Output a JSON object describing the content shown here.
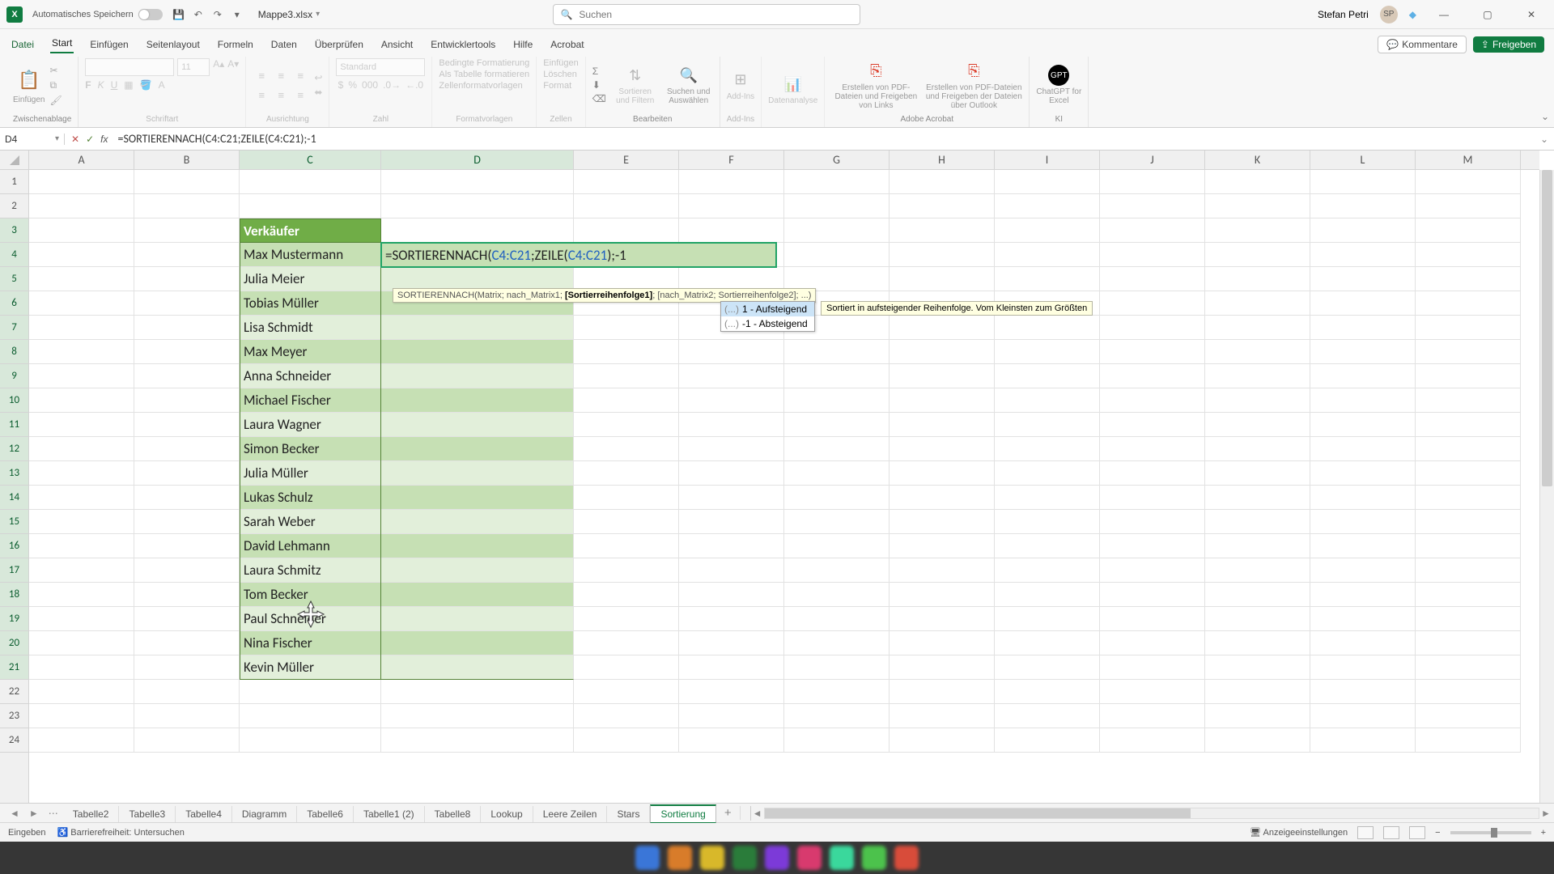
{
  "titlebar": {
    "autosave_label": "Automatisches Speichern",
    "filename": "Mappe3.xlsx",
    "search_placeholder": "Suchen",
    "user_name": "Stefan Petri"
  },
  "ribbon_tabs": {
    "file": "Datei",
    "start": "Start",
    "insert": "Einfügen",
    "page_layout": "Seitenlayout",
    "formulas": "Formeln",
    "data": "Daten",
    "review": "Überprüfen",
    "view": "Ansicht",
    "developer": "Entwicklertools",
    "help": "Hilfe",
    "acrobat": "Acrobat",
    "comments": "Kommentare",
    "share": "Freigeben"
  },
  "ribbon_groups": {
    "clipboard": "Zwischenablage",
    "paste": "Einfügen",
    "font": "Schriftart",
    "alignment": "Ausrichtung",
    "number": "Zahl",
    "number_format": "Standard",
    "styles": "Formatvorlagen",
    "cond_format": "Bedingte Formatierung",
    "as_table": "Als Tabelle formatieren",
    "cell_styles": "Zellenformatvorlagen",
    "cells": "Zellen",
    "insert_cells": "Einfügen",
    "delete": "Löschen",
    "format": "Format",
    "editing": "Bearbeiten",
    "sort_filter": "Sortieren und Filtern",
    "find_select": "Suchen und Auswählen",
    "addins": "Add-Ins",
    "addins_btn": "Add-Ins",
    "analysis": "Datenanalyse",
    "adobe": "Adobe Acrobat",
    "adobe1": "Erstellen von PDF-Dateien und Freigeben von Links",
    "adobe2": "Erstellen von PDF-Dateien und Freigeben der Dateien über Outlook",
    "ai": "KI",
    "gpt": "ChatGPT for Excel"
  },
  "name_box": "D4",
  "formula_bar": "=SORTIERENNACH(C4:C21;ZEILE(C4:C21);-1",
  "columns": [
    "A",
    "B",
    "C",
    "D",
    "E",
    "F",
    "G",
    "H",
    "I",
    "J",
    "K",
    "L",
    "M"
  ],
  "row_count": 24,
  "header_cell": "Verkäufer",
  "data_column": [
    "Max Mustermann",
    "Julia Meier",
    "Tobias Müller",
    "Lisa Schmidt",
    "Max Meyer",
    "Anna Schneider",
    "Michael Fischer",
    "Laura Wagner",
    "Simon Becker",
    "Julia Müller",
    "Lukas Schulz",
    "Sarah Weber",
    "David Lehmann",
    "Laura Schmitz",
    "Tom Becker",
    "Paul Schneider",
    "Nina Fischer",
    "Kevin Müller"
  ],
  "editing": {
    "prefix": "=SORTIERENNACH(",
    "ref1": "C4:C21",
    "mid": ";ZEILE(",
    "ref2": "C4:C21",
    "suffix": ");-1"
  },
  "tooltip_sig": "SORTIERENNACH(Matrix; nach_Matrix1; [Sortierreihenfolge1]; [nach_Matrix2; Sortierreihenfolge2]; ...)",
  "autocomplete": {
    "opt1_pre": "(...)",
    "opt1": "1 - Aufsteigend",
    "opt2_pre": "(...)",
    "opt2": "-1 - Absteigend",
    "desc": "Sortiert in aufsteigender Reihenfolge. Vom Kleinsten zum Größten"
  },
  "sheet_tabs": [
    "Tabelle2",
    "Tabelle3",
    "Tabelle4",
    "Diagramm",
    "Tabelle6",
    "Tabelle1 (2)",
    "Tabelle8",
    "Lookup",
    "Leere Zeilen",
    "Stars",
    "Sortierung"
  ],
  "active_sheet_index": 10,
  "status": {
    "mode": "Eingeben",
    "accessibility": "Barrierefreiheit: Untersuchen",
    "display_settings": "Anzeigeeinstellungen"
  }
}
